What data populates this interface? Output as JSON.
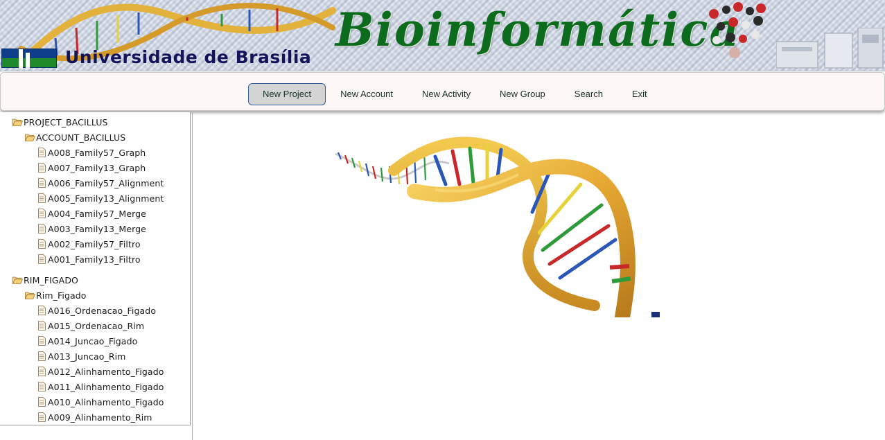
{
  "banner": {
    "university": "Universidade de Brasília",
    "title": "Bioinformática"
  },
  "menu": [
    {
      "label": "New Project",
      "active": true
    },
    {
      "label": "New Account",
      "active": false
    },
    {
      "label": "New Activity",
      "active": false
    },
    {
      "label": "New Group",
      "active": false
    },
    {
      "label": "Search",
      "active": false
    },
    {
      "label": "Exit",
      "active": false
    }
  ],
  "tree": [
    {
      "project": "PROJECT_BACILLUS",
      "account": "ACCOUNT_BACILLUS",
      "activities": [
        "A008_Family57_Graph",
        "A007_Family13_Graph",
        "A006_Family57_Alignment",
        "A005_Family13_Alignment",
        "A004_Family57_Merge",
        "A003_Family13_Merge",
        "A002_Family57_Filtro",
        "A001_Family13_Filtro"
      ]
    },
    {
      "project": "RIM_FIGADO",
      "account": "Rim_Figado",
      "activities": [
        "A016_Ordenacao_Figado",
        "A015_Ordenacao_Rim",
        "A014_Juncao_Figado",
        "A013_Juncao_Rim",
        "A012_Alinhamento_Figado",
        "A011_Alinhamento_Figado",
        "A010_Alinhamento_Figado",
        "A009_Alinhamento_Rim"
      ]
    }
  ],
  "colors": {
    "title_green": "#0d6b1e",
    "university_navy": "#14145a",
    "active_border": "#2f5f9a",
    "helix_gold": "#e6a832"
  }
}
